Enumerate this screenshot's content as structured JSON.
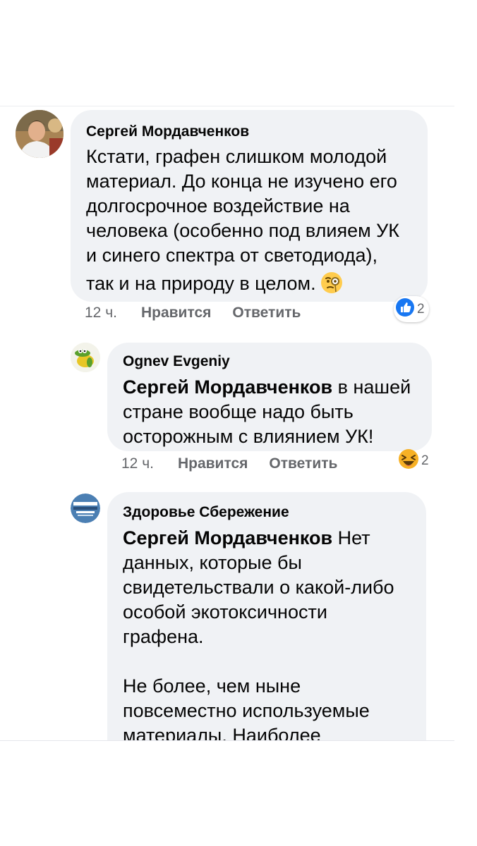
{
  "comments": [
    {
      "author": "Сергей Мордавченков",
      "text_lines": [
        "Кстати, графен слишком молодой",
        "материал. До конца не изучено его",
        "долгосрочное воздействие на",
        "человека (особенно под влияем УК",
        "и синего спектра от светодиода),",
        "так и на природу в целом."
      ],
      "emoji_icon": "face-with-monocle-icon",
      "time": "12 ч.",
      "like_label": "Нравится",
      "reply_label": "Ответить",
      "reaction_icon": "like-reaction-icon",
      "reaction_count": "2"
    },
    {
      "author": "Ognev Evgeniy",
      "mention": "Сергей Мордавченков",
      "text_first": " в нашей",
      "text_lines": [
        "стране вообще надо быть",
        "осторожным с влиянием УК!"
      ],
      "time": "12 ч.",
      "like_label": "Нравится",
      "reply_label": "Ответить",
      "reaction_icon": "haha-reaction-icon",
      "reaction_count": "2"
    },
    {
      "author": "Здоровье Сбережение",
      "mention": "Сергей Мордавченков",
      "text_first": " Нет",
      "text_lines": [
        "данных, которые бы",
        "свидетельствали о какой-либо",
        "особой экотоксичности",
        "графена.",
        "",
        "Не более, чем ныне",
        "повсеместно используемые",
        "материалы. Наиболее"
      ]
    }
  ],
  "colors": {
    "bubble": "#f0f2f5",
    "meta_text": "#65676b",
    "like_blue": "#1877f2",
    "haha_yellow": "#f7b125"
  }
}
